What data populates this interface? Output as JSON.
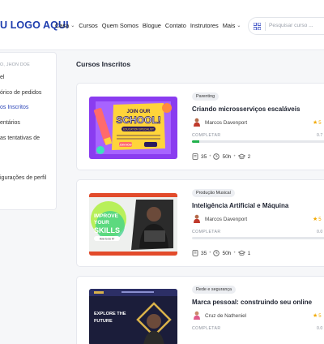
{
  "header": {
    "logo": "U LOGO AQUI",
    "nav": [
      {
        "label": "Casa",
        "caret": true
      },
      {
        "label": "Cursos",
        "caret": false
      },
      {
        "label": "Quem Somos",
        "caret": false
      },
      {
        "label": "Blogue",
        "caret": false
      },
      {
        "label": "Contato",
        "caret": false
      },
      {
        "label": "Instrutores",
        "caret": false
      },
      {
        "label": "Mais",
        "caret": true
      }
    ],
    "search_placeholder": "Pesquisar curso ..."
  },
  "sidebar": {
    "greeting": "O, JHON DOE",
    "items": [
      {
        "label": "el",
        "active": false
      },
      {
        "label": "órico de pedidos",
        "active": false
      },
      {
        "label": "os Inscritos",
        "active": true
      },
      {
        "label": "entários",
        "active": false
      },
      {
        "label": "as tentativas de",
        "active": false
      },
      {
        "label": "",
        "active": false
      },
      {
        "label": "igurações de perfil",
        "active": false
      }
    ]
  },
  "main": {
    "title": "Cursos Inscritos",
    "courses": [
      {
        "category": "Parenting",
        "title": "Criando microsserviços escaláveis",
        "author": "Marcos Davenport",
        "rating": "5",
        "status_label": "COMPLETAR",
        "progress_label": "0.7",
        "progress": 0.05,
        "lessons": "35",
        "duration": "50h",
        "students": "2",
        "thumb_text": {
          "line1": "JOIN OUR",
          "line2": "SCHOOL!",
          "line3": "EDUCATION SPECIALIST",
          "cta": "JOIN NOW"
        }
      },
      {
        "category": "Produção Musical",
        "title": "Inteligência Artificial e Máquina",
        "author": "Marcos Davenport",
        "rating": "5",
        "status_label": "COMPLETAR",
        "progress_label": "0.0",
        "progress": 0.0,
        "lessons": "35",
        "duration": "50h",
        "students": "1",
        "thumb_text": {
          "line1": "IMPROVE",
          "line2": "YOUR",
          "line3": "SKILLS",
          "sub": "How to do it?"
        }
      },
      {
        "category": "Rede e segurança",
        "title": "Marca pessoal: construindo seu online",
        "author": "Cruz de Natheniel",
        "rating": "5",
        "status_label": "COMPLETAR",
        "progress_label": "0.0",
        "progress": 0.0,
        "thumb_text": {
          "line1": "EXPLORE THE",
          "line2": "FUTURE"
        }
      }
    ]
  }
}
